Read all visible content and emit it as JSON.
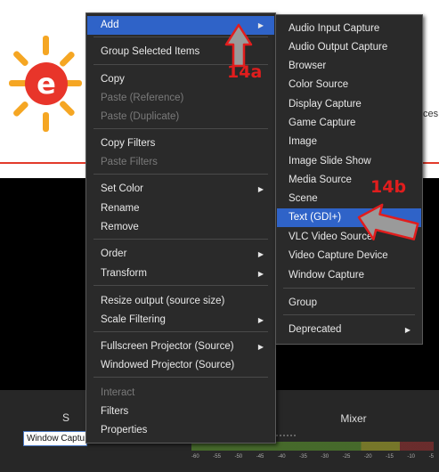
{
  "background": {
    "cut_text": "ces",
    "source_item": "Window Captu...",
    "sources_header": "S",
    "mixer_header": "Mixer",
    "meter_ticks": [
      "-60",
      "-55",
      "-50",
      "-45",
      "-40",
      "-35",
      "-30",
      "-25",
      "-20",
      "-15",
      "-10",
      "-5"
    ]
  },
  "context_menu": {
    "items": [
      {
        "label": "Add",
        "state": "highlight",
        "submenu": true
      },
      {
        "label": "Group Selected Items",
        "state": "normal"
      },
      {
        "label": "Copy",
        "state": "normal"
      },
      {
        "label": "Paste (Reference)",
        "state": "disabled"
      },
      {
        "label": "Paste (Duplicate)",
        "state": "disabled"
      },
      {
        "label": "Copy Filters",
        "state": "normal"
      },
      {
        "label": "Paste Filters",
        "state": "disabled"
      },
      {
        "label": "Set Color",
        "state": "normal",
        "submenu": true
      },
      {
        "label": "Rename",
        "state": "normal"
      },
      {
        "label": "Remove",
        "state": "normal"
      },
      {
        "label": "Order",
        "state": "normal",
        "submenu": true
      },
      {
        "label": "Transform",
        "state": "normal",
        "submenu": true
      },
      {
        "label": "Resize output (source size)",
        "state": "normal"
      },
      {
        "label": "Scale Filtering",
        "state": "normal",
        "submenu": true
      },
      {
        "label": "Fullscreen Projector (Source)",
        "state": "normal",
        "submenu": true
      },
      {
        "label": "Windowed Projector (Source)",
        "state": "normal"
      },
      {
        "label": "Interact",
        "state": "disabled"
      },
      {
        "label": "Filters",
        "state": "normal"
      },
      {
        "label": "Properties",
        "state": "normal"
      }
    ],
    "submenu_arrow": "▶"
  },
  "add_submenu": {
    "items": [
      {
        "label": "Audio Input Capture",
        "state": "normal"
      },
      {
        "label": "Audio Output Capture",
        "state": "normal"
      },
      {
        "label": "Browser",
        "state": "normal"
      },
      {
        "label": "Color Source",
        "state": "normal"
      },
      {
        "label": "Display Capture",
        "state": "normal"
      },
      {
        "label": "Game Capture",
        "state": "normal"
      },
      {
        "label": "Image",
        "state": "normal"
      },
      {
        "label": "Image Slide Show",
        "state": "normal"
      },
      {
        "label": "Media Source",
        "state": "normal"
      },
      {
        "label": "Scene",
        "state": "normal"
      },
      {
        "label": "Text (GDI+)",
        "state": "highlight"
      },
      {
        "label": "VLC Video Source",
        "state": "normal"
      },
      {
        "label": "Video Capture Device",
        "state": "normal"
      },
      {
        "label": "Window Capture",
        "state": "normal"
      },
      {
        "label": "Group",
        "state": "normal"
      },
      {
        "label": "Deprecated",
        "state": "normal",
        "submenu": true
      }
    ]
  },
  "annotations": {
    "label_a": "14a",
    "label_b": "14b",
    "annotation_color": "#e11d1d",
    "highlight_color": "#2f63c8"
  }
}
